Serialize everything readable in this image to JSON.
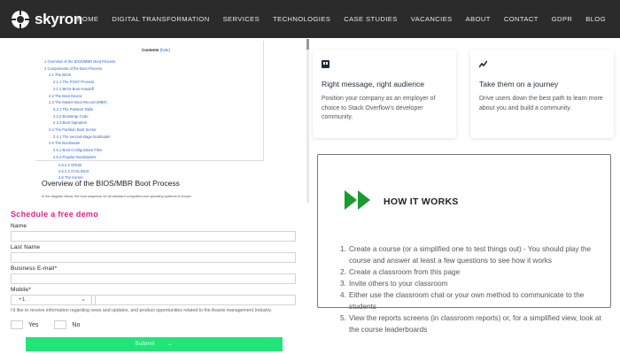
{
  "brand": {
    "name": "skyron"
  },
  "nav": [
    "HOME",
    "DIGITAL TRANSFORMATION",
    "SERVICES",
    "TECHNOLOGIES",
    "CASE STUDIES",
    "VACANCIES",
    "ABOUT",
    "CONTACT",
    "GDPR",
    "BLOG"
  ],
  "toc": {
    "title": "Contents",
    "hide_label": "[hide]",
    "items": [
      "1 Overview of the BIOS/MBR Boot Process",
      "2 Components of the Boot Process",
      "2.1 The BIOS",
      "2.1.1 The POST Process",
      "2.1.2 BIOS Boot Handoff",
      "2.2 The Boot Device",
      "2.3 The Master Boot Record (MBR)",
      "2.3.1 The Partition Table",
      "2.3.2 Bootstrap Code",
      "2.3.3 Boot Signature",
      "2.4 The Partition Boot Sector",
      "2.4.1 The second-stage bootloader",
      "2.5 The Bootloader",
      "2.5.1 Boot Configuration Files",
      "2.5.2 Popular Bootloaders",
      "2.5.2.1 NTLDR",
      "2.5.2.2 BOOTMGR",
      "2.5.2.3 GRUB",
      "2.5.2.4 SYSLINUX"
    ],
    "overflow_items": [
      "2.5.2.3 GRUB",
      "2.5.2.4 SYSLINUX",
      "2.6 The Kernel"
    ]
  },
  "article": {
    "heading": "Overview of the BIOS/MBR Boot Process",
    "body": "In the diagram below, the boot sequence for all standard computers and operating systems is shown:"
  },
  "form": {
    "title": "Schedule a free demo",
    "name_label": "Name",
    "last_name_label": "Last Name",
    "email_label": "Business E-mail*",
    "mobile_label": "Mobile*",
    "mobile_code": "+1",
    "consent": "I'd like to receive information regarding news and updates, and product opportunities related to the Assets management Industry.",
    "yes_label": "Yes",
    "no_label": "No",
    "submit_label": "Submit",
    "submit_arrow": "→"
  },
  "cards": [
    {
      "icon": "quote-icon",
      "title": "Right message, right audience",
      "body": "Position your company as an employer of choice to Stack Overflow's developer community."
    },
    {
      "icon": "trend-icon",
      "title": "Take them on a journey",
      "body": "Drive users down the best path to learn more about you and build a community."
    }
  ],
  "how": {
    "title": "HOW IT WORKS",
    "accent": "#1a9b2f",
    "steps": [
      "Create a course (or a simplified one to test things out) - You should play the course and answer at least a few questions to see how it works",
      "Create a classroom from this page",
      "Invite others to your classroom",
      "Either use the classroom chat or your own method to communicate to the students",
      "View the reports screens (in classroom reports) or, for a simplified view, look at the course leaderboards"
    ]
  }
}
